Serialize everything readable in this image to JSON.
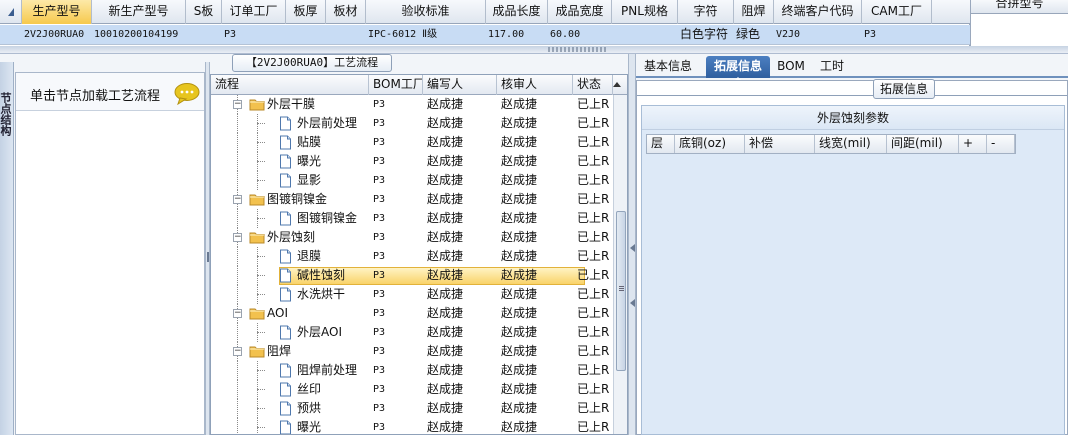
{
  "top_grid": {
    "columns": [
      "生产型号",
      "新生产型号",
      "S板",
      "订单工厂",
      "板厚",
      "板材",
      "验收标准",
      "成品长度",
      "成品宽度",
      "PNL规格",
      "字符",
      "阻焊",
      "终端客户代码",
      "CAM工厂"
    ],
    "row": [
      "2V2J00RUA0",
      "10010200104199",
      "",
      "P3",
      "",
      "",
      "IPC-6012 Ⅱ级",
      "117.00",
      "60.00",
      "",
      "白色字符",
      "绿色",
      "V2J0",
      "P3"
    ],
    "merge_label": "合拼型号"
  },
  "left_panel": {
    "vertical_tab": "节点结构",
    "hint": "单击节点加载工艺流程",
    "bubble_icon": "speech-bubble-icon"
  },
  "process": {
    "title": "【2V2J00RUA0】工艺流程",
    "headers": [
      "流程",
      "BOM工厂",
      "编写人",
      "核审人",
      "状态"
    ],
    "rows": [
      {
        "name": "外层干膜",
        "type": "folder",
        "level": 1,
        "bom": "P3",
        "writer": "赵成捷",
        "reviewer": "赵成捷",
        "status": "已上R"
      },
      {
        "name": "外层前处理",
        "type": "doc",
        "level": 2,
        "bom": "P3",
        "writer": "赵成捷",
        "reviewer": "赵成捷",
        "status": "已上R"
      },
      {
        "name": "贴膜",
        "type": "doc",
        "level": 2,
        "bom": "P3",
        "writer": "赵成捷",
        "reviewer": "赵成捷",
        "status": "已上R"
      },
      {
        "name": "曝光",
        "type": "doc",
        "level": 2,
        "bom": "P3",
        "writer": "赵成捷",
        "reviewer": "赵成捷",
        "status": "已上R"
      },
      {
        "name": "显影",
        "type": "doc",
        "level": 2,
        "bom": "P3",
        "writer": "赵成捷",
        "reviewer": "赵成捷",
        "status": "已上R"
      },
      {
        "name": "图镀铜镍金",
        "type": "folder",
        "level": 1,
        "bom": "P3",
        "writer": "赵成捷",
        "reviewer": "赵成捷",
        "status": "已上R"
      },
      {
        "name": "图镀铜镍金",
        "type": "doc",
        "level": 2,
        "bom": "P3",
        "writer": "赵成捷",
        "reviewer": "赵成捷",
        "status": "已上R"
      },
      {
        "name": "外层蚀刻",
        "type": "folder",
        "level": 1,
        "bom": "P3",
        "writer": "赵成捷",
        "reviewer": "赵成捷",
        "status": "已上R"
      },
      {
        "name": "退膜",
        "type": "doc",
        "level": 2,
        "bom": "P3",
        "writer": "赵成捷",
        "reviewer": "赵成捷",
        "status": "已上R"
      },
      {
        "name": "碱性蚀刻",
        "type": "doc",
        "level": 2,
        "bom": "P3",
        "writer": "赵成捷",
        "reviewer": "赵成捷",
        "status": "已上R",
        "selected": true
      },
      {
        "name": "水洗烘干",
        "type": "doc",
        "level": 2,
        "bom": "P3",
        "writer": "赵成捷",
        "reviewer": "赵成捷",
        "status": "已上R"
      },
      {
        "name": "AOI",
        "type": "folder",
        "level": 1,
        "bom": "P3",
        "writer": "赵成捷",
        "reviewer": "赵成捷",
        "status": "已上R"
      },
      {
        "name": "外层AOI",
        "type": "doc",
        "level": 2,
        "bom": "P3",
        "writer": "赵成捷",
        "reviewer": "赵成捷",
        "status": "已上R"
      },
      {
        "name": "阻焊",
        "type": "folder",
        "level": 1,
        "bom": "P3",
        "writer": "赵成捷",
        "reviewer": "赵成捷",
        "status": "已上R"
      },
      {
        "name": "阻焊前处理",
        "type": "doc",
        "level": 2,
        "bom": "P3",
        "writer": "赵成捷",
        "reviewer": "赵成捷",
        "status": "已上R"
      },
      {
        "name": "丝印",
        "type": "doc",
        "level": 2,
        "bom": "P3",
        "writer": "赵成捷",
        "reviewer": "赵成捷",
        "status": "已上R"
      },
      {
        "name": "预烘",
        "type": "doc",
        "level": 2,
        "bom": "P3",
        "writer": "赵成捷",
        "reviewer": "赵成捷",
        "status": "已上R"
      },
      {
        "name": "曝光",
        "type": "doc",
        "level": 2,
        "bom": "P3",
        "writer": "赵成捷",
        "reviewer": "赵成捷",
        "status": "已上R"
      }
    ]
  },
  "right_panel": {
    "tabs": [
      "基本信息",
      "拓展信息",
      "BOM",
      "工时"
    ],
    "active_tab": "拓展信息",
    "group_legend": "拓展信息",
    "section_title": "外层蚀刻参数",
    "grid_headers": [
      "层",
      "底铜(oz)",
      "补偿",
      "线宽(mil)",
      "间距(mil)",
      "+",
      "-"
    ]
  },
  "colors": {
    "selection": "#f9d36a",
    "header_row_selected": "#c8dcf4",
    "tab_active": "#2f5f9f",
    "folder": "#f2c14e"
  }
}
